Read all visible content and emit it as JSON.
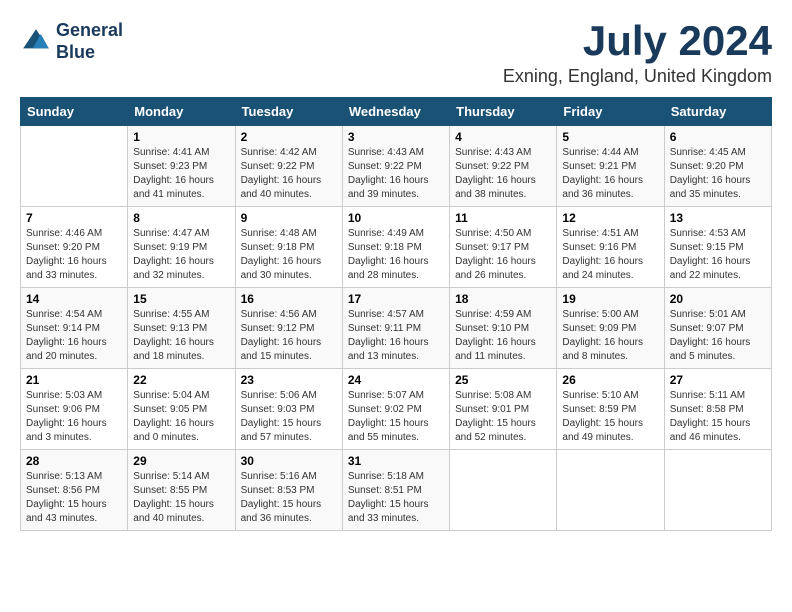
{
  "logo": {
    "line1": "General",
    "line2": "Blue"
  },
  "title": "July 2024",
  "location": "Exning, England, United Kingdom",
  "days_of_week": [
    "Sunday",
    "Monday",
    "Tuesday",
    "Wednesday",
    "Thursday",
    "Friday",
    "Saturday"
  ],
  "weeks": [
    [
      {
        "day": "",
        "sunrise": "",
        "sunset": "",
        "daylight": ""
      },
      {
        "day": "1",
        "sunrise": "Sunrise: 4:41 AM",
        "sunset": "Sunset: 9:23 PM",
        "daylight": "Daylight: 16 hours and 41 minutes."
      },
      {
        "day": "2",
        "sunrise": "Sunrise: 4:42 AM",
        "sunset": "Sunset: 9:22 PM",
        "daylight": "Daylight: 16 hours and 40 minutes."
      },
      {
        "day": "3",
        "sunrise": "Sunrise: 4:43 AM",
        "sunset": "Sunset: 9:22 PM",
        "daylight": "Daylight: 16 hours and 39 minutes."
      },
      {
        "day": "4",
        "sunrise": "Sunrise: 4:43 AM",
        "sunset": "Sunset: 9:22 PM",
        "daylight": "Daylight: 16 hours and 38 minutes."
      },
      {
        "day": "5",
        "sunrise": "Sunrise: 4:44 AM",
        "sunset": "Sunset: 9:21 PM",
        "daylight": "Daylight: 16 hours and 36 minutes."
      },
      {
        "day": "6",
        "sunrise": "Sunrise: 4:45 AM",
        "sunset": "Sunset: 9:20 PM",
        "daylight": "Daylight: 16 hours and 35 minutes."
      }
    ],
    [
      {
        "day": "7",
        "sunrise": "Sunrise: 4:46 AM",
        "sunset": "Sunset: 9:20 PM",
        "daylight": "Daylight: 16 hours and 33 minutes."
      },
      {
        "day": "8",
        "sunrise": "Sunrise: 4:47 AM",
        "sunset": "Sunset: 9:19 PM",
        "daylight": "Daylight: 16 hours and 32 minutes."
      },
      {
        "day": "9",
        "sunrise": "Sunrise: 4:48 AM",
        "sunset": "Sunset: 9:18 PM",
        "daylight": "Daylight: 16 hours and 30 minutes."
      },
      {
        "day": "10",
        "sunrise": "Sunrise: 4:49 AM",
        "sunset": "Sunset: 9:18 PM",
        "daylight": "Daylight: 16 hours and 28 minutes."
      },
      {
        "day": "11",
        "sunrise": "Sunrise: 4:50 AM",
        "sunset": "Sunset: 9:17 PM",
        "daylight": "Daylight: 16 hours and 26 minutes."
      },
      {
        "day": "12",
        "sunrise": "Sunrise: 4:51 AM",
        "sunset": "Sunset: 9:16 PM",
        "daylight": "Daylight: 16 hours and 24 minutes."
      },
      {
        "day": "13",
        "sunrise": "Sunrise: 4:53 AM",
        "sunset": "Sunset: 9:15 PM",
        "daylight": "Daylight: 16 hours and 22 minutes."
      }
    ],
    [
      {
        "day": "14",
        "sunrise": "Sunrise: 4:54 AM",
        "sunset": "Sunset: 9:14 PM",
        "daylight": "Daylight: 16 hours and 20 minutes."
      },
      {
        "day": "15",
        "sunrise": "Sunrise: 4:55 AM",
        "sunset": "Sunset: 9:13 PM",
        "daylight": "Daylight: 16 hours and 18 minutes."
      },
      {
        "day": "16",
        "sunrise": "Sunrise: 4:56 AM",
        "sunset": "Sunset: 9:12 PM",
        "daylight": "Daylight: 16 hours and 15 minutes."
      },
      {
        "day": "17",
        "sunrise": "Sunrise: 4:57 AM",
        "sunset": "Sunset: 9:11 PM",
        "daylight": "Daylight: 16 hours and 13 minutes."
      },
      {
        "day": "18",
        "sunrise": "Sunrise: 4:59 AM",
        "sunset": "Sunset: 9:10 PM",
        "daylight": "Daylight: 16 hours and 11 minutes."
      },
      {
        "day": "19",
        "sunrise": "Sunrise: 5:00 AM",
        "sunset": "Sunset: 9:09 PM",
        "daylight": "Daylight: 16 hours and 8 minutes."
      },
      {
        "day": "20",
        "sunrise": "Sunrise: 5:01 AM",
        "sunset": "Sunset: 9:07 PM",
        "daylight": "Daylight: 16 hours and 5 minutes."
      }
    ],
    [
      {
        "day": "21",
        "sunrise": "Sunrise: 5:03 AM",
        "sunset": "Sunset: 9:06 PM",
        "daylight": "Daylight: 16 hours and 3 minutes."
      },
      {
        "day": "22",
        "sunrise": "Sunrise: 5:04 AM",
        "sunset": "Sunset: 9:05 PM",
        "daylight": "Daylight: 16 hours and 0 minutes."
      },
      {
        "day": "23",
        "sunrise": "Sunrise: 5:06 AM",
        "sunset": "Sunset: 9:03 PM",
        "daylight": "Daylight: 15 hours and 57 minutes."
      },
      {
        "day": "24",
        "sunrise": "Sunrise: 5:07 AM",
        "sunset": "Sunset: 9:02 PM",
        "daylight": "Daylight: 15 hours and 55 minutes."
      },
      {
        "day": "25",
        "sunrise": "Sunrise: 5:08 AM",
        "sunset": "Sunset: 9:01 PM",
        "daylight": "Daylight: 15 hours and 52 minutes."
      },
      {
        "day": "26",
        "sunrise": "Sunrise: 5:10 AM",
        "sunset": "Sunset: 8:59 PM",
        "daylight": "Daylight: 15 hours and 49 minutes."
      },
      {
        "day": "27",
        "sunrise": "Sunrise: 5:11 AM",
        "sunset": "Sunset: 8:58 PM",
        "daylight": "Daylight: 15 hours and 46 minutes."
      }
    ],
    [
      {
        "day": "28",
        "sunrise": "Sunrise: 5:13 AM",
        "sunset": "Sunset: 8:56 PM",
        "daylight": "Daylight: 15 hours and 43 minutes."
      },
      {
        "day": "29",
        "sunrise": "Sunrise: 5:14 AM",
        "sunset": "Sunset: 8:55 PM",
        "daylight": "Daylight: 15 hours and 40 minutes."
      },
      {
        "day": "30",
        "sunrise": "Sunrise: 5:16 AM",
        "sunset": "Sunset: 8:53 PM",
        "daylight": "Daylight: 15 hours and 36 minutes."
      },
      {
        "day": "31",
        "sunrise": "Sunrise: 5:18 AM",
        "sunset": "Sunset: 8:51 PM",
        "daylight": "Daylight: 15 hours and 33 minutes."
      },
      {
        "day": "",
        "sunrise": "",
        "sunset": "",
        "daylight": ""
      },
      {
        "day": "",
        "sunrise": "",
        "sunset": "",
        "daylight": ""
      },
      {
        "day": "",
        "sunrise": "",
        "sunset": "",
        "daylight": ""
      }
    ]
  ]
}
